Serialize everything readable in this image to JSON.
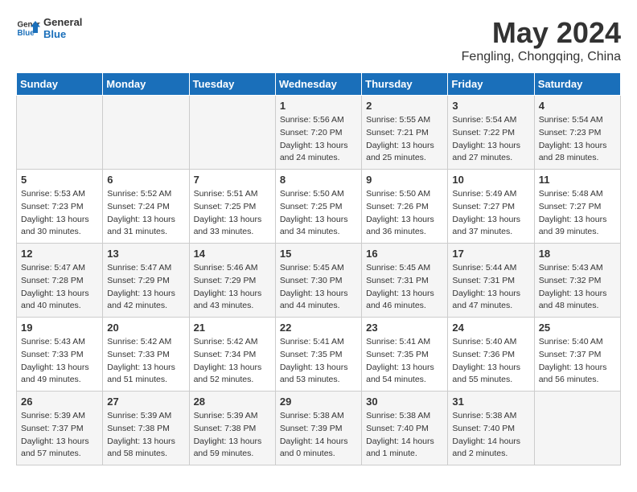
{
  "header": {
    "logo_line1": "General",
    "logo_line2": "Blue",
    "title": "May 2024",
    "subtitle": "Fengling, Chongqing, China"
  },
  "days_of_week": [
    "Sunday",
    "Monday",
    "Tuesday",
    "Wednesday",
    "Thursday",
    "Friday",
    "Saturday"
  ],
  "weeks": [
    [
      {
        "day": "",
        "sunrise": "",
        "sunset": "",
        "daylight": ""
      },
      {
        "day": "",
        "sunrise": "",
        "sunset": "",
        "daylight": ""
      },
      {
        "day": "",
        "sunrise": "",
        "sunset": "",
        "daylight": ""
      },
      {
        "day": "1",
        "sunrise": "Sunrise: 5:56 AM",
        "sunset": "Sunset: 7:20 PM",
        "daylight": "Daylight: 13 hours and 24 minutes."
      },
      {
        "day": "2",
        "sunrise": "Sunrise: 5:55 AM",
        "sunset": "Sunset: 7:21 PM",
        "daylight": "Daylight: 13 hours and 25 minutes."
      },
      {
        "day": "3",
        "sunrise": "Sunrise: 5:54 AM",
        "sunset": "Sunset: 7:22 PM",
        "daylight": "Daylight: 13 hours and 27 minutes."
      },
      {
        "day": "4",
        "sunrise": "Sunrise: 5:54 AM",
        "sunset": "Sunset: 7:23 PM",
        "daylight": "Daylight: 13 hours and 28 minutes."
      }
    ],
    [
      {
        "day": "5",
        "sunrise": "Sunrise: 5:53 AM",
        "sunset": "Sunset: 7:23 PM",
        "daylight": "Daylight: 13 hours and 30 minutes."
      },
      {
        "day": "6",
        "sunrise": "Sunrise: 5:52 AM",
        "sunset": "Sunset: 7:24 PM",
        "daylight": "Daylight: 13 hours and 31 minutes."
      },
      {
        "day": "7",
        "sunrise": "Sunrise: 5:51 AM",
        "sunset": "Sunset: 7:25 PM",
        "daylight": "Daylight: 13 hours and 33 minutes."
      },
      {
        "day": "8",
        "sunrise": "Sunrise: 5:50 AM",
        "sunset": "Sunset: 7:25 PM",
        "daylight": "Daylight: 13 hours and 34 minutes."
      },
      {
        "day": "9",
        "sunrise": "Sunrise: 5:50 AM",
        "sunset": "Sunset: 7:26 PM",
        "daylight": "Daylight: 13 hours and 36 minutes."
      },
      {
        "day": "10",
        "sunrise": "Sunrise: 5:49 AM",
        "sunset": "Sunset: 7:27 PM",
        "daylight": "Daylight: 13 hours and 37 minutes."
      },
      {
        "day": "11",
        "sunrise": "Sunrise: 5:48 AM",
        "sunset": "Sunset: 7:27 PM",
        "daylight": "Daylight: 13 hours and 39 minutes."
      }
    ],
    [
      {
        "day": "12",
        "sunrise": "Sunrise: 5:47 AM",
        "sunset": "Sunset: 7:28 PM",
        "daylight": "Daylight: 13 hours and 40 minutes."
      },
      {
        "day": "13",
        "sunrise": "Sunrise: 5:47 AM",
        "sunset": "Sunset: 7:29 PM",
        "daylight": "Daylight: 13 hours and 42 minutes."
      },
      {
        "day": "14",
        "sunrise": "Sunrise: 5:46 AM",
        "sunset": "Sunset: 7:29 PM",
        "daylight": "Daylight: 13 hours and 43 minutes."
      },
      {
        "day": "15",
        "sunrise": "Sunrise: 5:45 AM",
        "sunset": "Sunset: 7:30 PM",
        "daylight": "Daylight: 13 hours and 44 minutes."
      },
      {
        "day": "16",
        "sunrise": "Sunrise: 5:45 AM",
        "sunset": "Sunset: 7:31 PM",
        "daylight": "Daylight: 13 hours and 46 minutes."
      },
      {
        "day": "17",
        "sunrise": "Sunrise: 5:44 AM",
        "sunset": "Sunset: 7:31 PM",
        "daylight": "Daylight: 13 hours and 47 minutes."
      },
      {
        "day": "18",
        "sunrise": "Sunrise: 5:43 AM",
        "sunset": "Sunset: 7:32 PM",
        "daylight": "Daylight: 13 hours and 48 minutes."
      }
    ],
    [
      {
        "day": "19",
        "sunrise": "Sunrise: 5:43 AM",
        "sunset": "Sunset: 7:33 PM",
        "daylight": "Daylight: 13 hours and 49 minutes."
      },
      {
        "day": "20",
        "sunrise": "Sunrise: 5:42 AM",
        "sunset": "Sunset: 7:33 PM",
        "daylight": "Daylight: 13 hours and 51 minutes."
      },
      {
        "day": "21",
        "sunrise": "Sunrise: 5:42 AM",
        "sunset": "Sunset: 7:34 PM",
        "daylight": "Daylight: 13 hours and 52 minutes."
      },
      {
        "day": "22",
        "sunrise": "Sunrise: 5:41 AM",
        "sunset": "Sunset: 7:35 PM",
        "daylight": "Daylight: 13 hours and 53 minutes."
      },
      {
        "day": "23",
        "sunrise": "Sunrise: 5:41 AM",
        "sunset": "Sunset: 7:35 PM",
        "daylight": "Daylight: 13 hours and 54 minutes."
      },
      {
        "day": "24",
        "sunrise": "Sunrise: 5:40 AM",
        "sunset": "Sunset: 7:36 PM",
        "daylight": "Daylight: 13 hours and 55 minutes."
      },
      {
        "day": "25",
        "sunrise": "Sunrise: 5:40 AM",
        "sunset": "Sunset: 7:37 PM",
        "daylight": "Daylight: 13 hours and 56 minutes."
      }
    ],
    [
      {
        "day": "26",
        "sunrise": "Sunrise: 5:39 AM",
        "sunset": "Sunset: 7:37 PM",
        "daylight": "Daylight: 13 hours and 57 minutes."
      },
      {
        "day": "27",
        "sunrise": "Sunrise: 5:39 AM",
        "sunset": "Sunset: 7:38 PM",
        "daylight": "Daylight: 13 hours and 58 minutes."
      },
      {
        "day": "28",
        "sunrise": "Sunrise: 5:39 AM",
        "sunset": "Sunset: 7:38 PM",
        "daylight": "Daylight: 13 hours and 59 minutes."
      },
      {
        "day": "29",
        "sunrise": "Sunrise: 5:38 AM",
        "sunset": "Sunset: 7:39 PM",
        "daylight": "Daylight: 14 hours and 0 minutes."
      },
      {
        "day": "30",
        "sunrise": "Sunrise: 5:38 AM",
        "sunset": "Sunset: 7:40 PM",
        "daylight": "Daylight: 14 hours and 1 minute."
      },
      {
        "day": "31",
        "sunrise": "Sunrise: 5:38 AM",
        "sunset": "Sunset: 7:40 PM",
        "daylight": "Daylight: 14 hours and 2 minutes."
      },
      {
        "day": "",
        "sunrise": "",
        "sunset": "",
        "daylight": ""
      }
    ]
  ]
}
